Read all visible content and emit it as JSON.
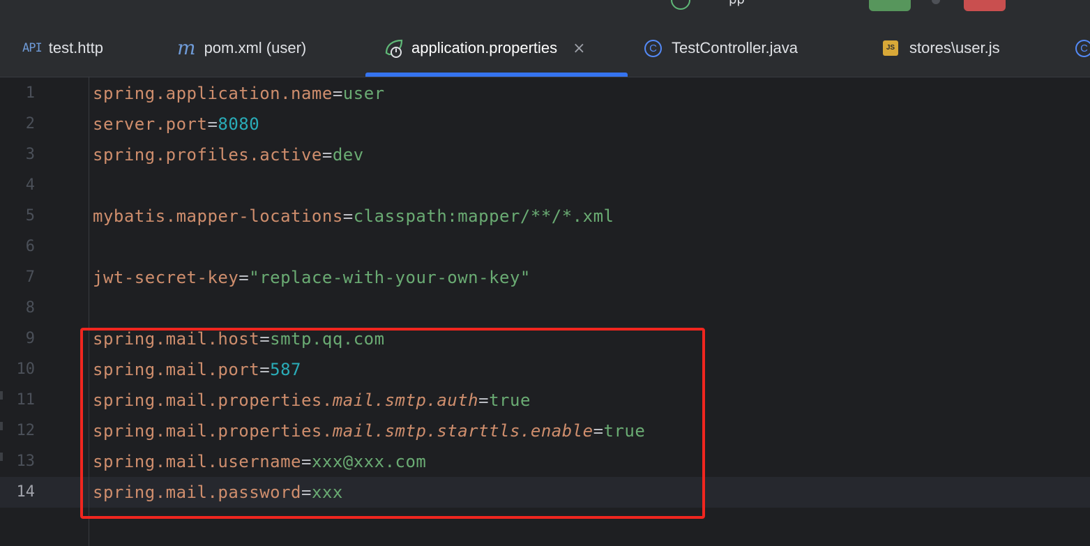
{
  "title_bar": {
    "app_text": "pp",
    "run_icon": "spring-run-icon"
  },
  "tabs": [
    {
      "label": "test.http",
      "icon": "api-icon",
      "icon_text": "API"
    },
    {
      "label": "pom.xml (user)",
      "icon": "maven-icon",
      "icon_text": "m"
    },
    {
      "label": "application.properties",
      "icon": "spring-properties-icon",
      "active": true,
      "close": "×"
    },
    {
      "label": "TestController.java",
      "icon": "java-class-icon",
      "icon_text": "C"
    },
    {
      "label": "stores\\user.js",
      "icon": "javascript-icon",
      "icon_text": "JS"
    },
    {
      "label": "",
      "icon": "java-class-icon",
      "icon_text": "C"
    }
  ],
  "editor": {
    "current_line": 14,
    "lines": [
      {
        "num": "1",
        "tokens": [
          [
            "k",
            "spring.application.name"
          ],
          [
            "eq",
            "="
          ],
          [
            "v",
            "user"
          ]
        ]
      },
      {
        "num": "2",
        "tokens": [
          [
            "k",
            "server.port"
          ],
          [
            "eq",
            "="
          ],
          [
            "n",
            "8080"
          ]
        ]
      },
      {
        "num": "3",
        "tokens": [
          [
            "k",
            "spring.profiles.active"
          ],
          [
            "eq",
            "="
          ],
          [
            "v",
            "dev"
          ]
        ]
      },
      {
        "num": "4",
        "tokens": []
      },
      {
        "num": "5",
        "tokens": [
          [
            "k",
            "mybatis.mapper-locations"
          ],
          [
            "eq",
            "="
          ],
          [
            "v",
            "classpath:mapper/**/*.xml"
          ]
        ]
      },
      {
        "num": "6",
        "tokens": []
      },
      {
        "num": "7",
        "tokens": [
          [
            "k",
            "jwt-secret-key"
          ],
          [
            "eq",
            "="
          ],
          [
            "v",
            "\"replace-with-your-own-key\""
          ]
        ]
      },
      {
        "num": "8",
        "tokens": []
      },
      {
        "num": "9",
        "tokens": [
          [
            "k",
            "spring.mail.host"
          ],
          [
            "eq",
            "="
          ],
          [
            "v",
            "smtp.qq.com"
          ]
        ]
      },
      {
        "num": "10",
        "tokens": [
          [
            "k",
            "spring.mail.port"
          ],
          [
            "eq",
            "="
          ],
          [
            "n",
            "587"
          ]
        ]
      },
      {
        "num": "11",
        "tokens": [
          [
            "k",
            "spring.mail.properties."
          ],
          [
            "ki",
            "mail.smtp.auth"
          ],
          [
            "eq",
            "="
          ],
          [
            "v",
            "true"
          ]
        ]
      },
      {
        "num": "12",
        "tokens": [
          [
            "k",
            "spring.mail.properties."
          ],
          [
            "ki",
            "mail.smtp.starttls.enable"
          ],
          [
            "eq",
            "="
          ],
          [
            "v",
            "true"
          ]
        ]
      },
      {
        "num": "13",
        "tokens": [
          [
            "k",
            "spring.mail.username"
          ],
          [
            "eq",
            "="
          ],
          [
            "v",
            "xxx@xxx.com"
          ]
        ]
      },
      {
        "num": "14",
        "tokens": [
          [
            "k",
            "spring.mail.password"
          ],
          [
            "eq",
            "="
          ],
          [
            "v",
            "xxx"
          ]
        ]
      }
    ]
  },
  "colors": {
    "key": "#cf8e6d",
    "value": "#6aab73",
    "number": "#2aacb8",
    "highlight_border": "#f0261f",
    "active_tab_indicator": "#3574f0"
  }
}
